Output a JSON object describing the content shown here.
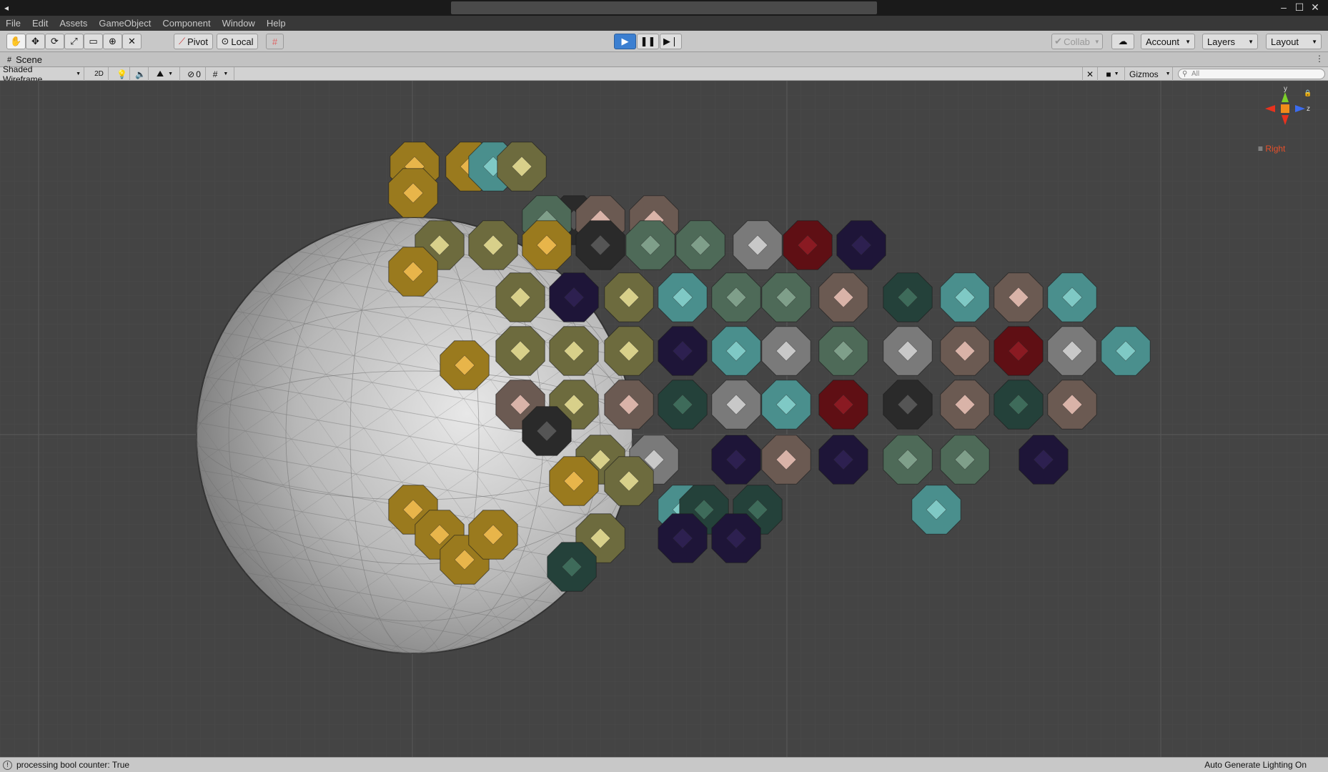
{
  "window": {
    "app_icon": "unity-icon"
  },
  "menu": [
    "File",
    "Edit",
    "Assets",
    "GameObject",
    "Component",
    "Window",
    "Help"
  ],
  "toolbar": {
    "tools": [
      "hand-icon",
      "move-icon",
      "rotate-icon",
      "scale-icon",
      "rect-icon",
      "transform-icon",
      "custom-tool-icon"
    ],
    "pivot_label": "Pivot",
    "local_label": "Local",
    "collab_label": "Collab",
    "account_label": "Account",
    "layers_label": "Layers",
    "layout_label": "Layout"
  },
  "scene_tab": {
    "label": "Scene"
  },
  "scene_toolbar": {
    "draw_mode": "Shaded Wireframe",
    "mode_2d": "2D",
    "hidden_count": "0",
    "gizmos_label": "Gizmos",
    "search_placeholder": "All"
  },
  "gizmo": {
    "view_label": "Right",
    "axes": {
      "y": "y",
      "z": "z"
    }
  },
  "status": {
    "message": "processing bool counter: True",
    "lighting": "Auto Generate Lighting On"
  },
  "colors": {
    "play_active": "#3b7fd1",
    "view_label": "#e8502a",
    "axis_y": "#7ccf2a",
    "axis_z": "#3b6cf0",
    "axis_x": "#e8321e"
  }
}
